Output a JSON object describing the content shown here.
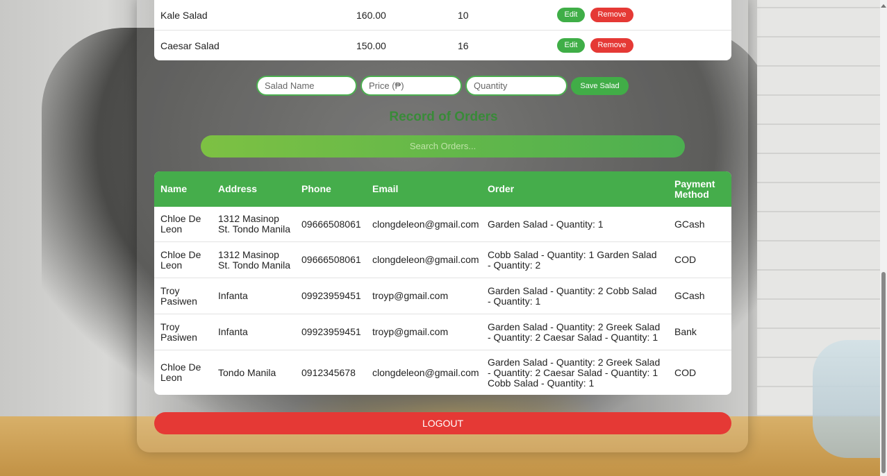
{
  "salads": [
    {
      "name": "Kale Salad",
      "price": "160.00",
      "quantity": "10"
    },
    {
      "name": "Caesar Salad",
      "price": "150.00",
      "quantity": "16"
    }
  ],
  "salad_actions": {
    "edit": "Edit",
    "remove": "Remove"
  },
  "add_form": {
    "name_placeholder": "Salad Name",
    "price_placeholder": "Price (₱)",
    "quantity_placeholder": "Quantity",
    "save_label": "Save Salad"
  },
  "orders_section": {
    "heading": "Record of Orders",
    "search_placeholder": "Search Orders...",
    "columns": [
      "Name",
      "Address",
      "Phone",
      "Email",
      "Order",
      "Payment Method"
    ],
    "rows": [
      {
        "name": "Chloe De Leon",
        "address": "1312 Masinop St. Tondo Manila",
        "phone": "09666508061",
        "email": "clongdeleon@gmail.com",
        "order": "Garden Salad - Quantity: 1",
        "payment": "GCash"
      },
      {
        "name": "Chloe De Leon",
        "address": "1312 Masinop St. Tondo Manila",
        "phone": "09666508061",
        "email": "clongdeleon@gmail.com",
        "order": "Cobb Salad - Quantity: 1 Garden Salad - Quantity: 2",
        "payment": "COD"
      },
      {
        "name": "Troy Pasiwen",
        "address": "Infanta",
        "phone": "09923959451",
        "email": "troyp@gmail.com",
        "order": "Garden Salad - Quantity: 2 Cobb Salad - Quantity: 1",
        "payment": "GCash"
      },
      {
        "name": "Troy Pasiwen",
        "address": "Infanta",
        "phone": "09923959451",
        "email": "troyp@gmail.com",
        "order": "Garden Salad - Quantity: 2 Greek Salad - Quantity: 2 Caesar Salad - Quantity: 1",
        "payment": "Bank"
      },
      {
        "name": "Chloe De Leon",
        "address": "Tondo Manila",
        "phone": "0912345678",
        "email": "clongdeleon@gmail.com",
        "order": "Garden Salad - Quantity: 2 Greek Salad - Quantity: 2 Caesar Salad - Quantity: 1 Cobb Salad - Quantity: 1",
        "payment": "COD"
      }
    ]
  },
  "logout_label": "LOGOUT",
  "colors": {
    "accent_green": "#45ad4b",
    "danger_red": "#e53935"
  }
}
